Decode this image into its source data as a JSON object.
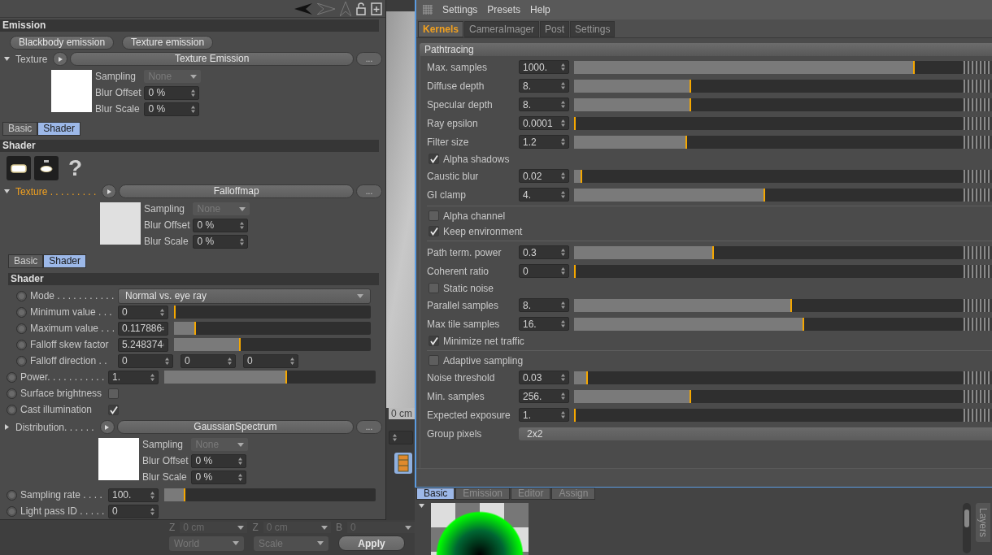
{
  "attribute_panel": {
    "blocks": [
      {
        "kind": "header",
        "title": "Emission"
      },
      {
        "kind": "buttons",
        "buttons": [
          "Blackbody emission",
          "Texture emission"
        ]
      },
      {
        "kind": "link",
        "label": "Texture",
        "expanded": true,
        "highlighted": false,
        "shader": "Texture Emission",
        "more": "...",
        "color": "#ffffff",
        "params": [
          {
            "kind": "dropdown",
            "label": "Sampling",
            "value": "None",
            "disabled": true
          },
          {
            "kind": "spinner",
            "label": "Blur Offset",
            "value": "0 %"
          },
          {
            "kind": "spinner",
            "label": "Blur Scale",
            "value": "0 %"
          }
        ]
      },
      {
        "kind": "tabs",
        "tabs": [
          {
            "label": "Basic",
            "selected": false
          },
          {
            "label": "Shader",
            "selected": true
          }
        ]
      },
      {
        "kind": "header",
        "title": "Shader"
      },
      {
        "kind": "icons",
        "help": "?"
      },
      {
        "kind": "link",
        "label": "Texture . . . . . . . . .",
        "expanded": true,
        "highlighted": true,
        "shader": "Falloffmap",
        "more": "...",
        "color": "#e0e0e0",
        "params": [
          {
            "kind": "dropdown",
            "label": "Sampling",
            "value": "None",
            "disabled": true
          },
          {
            "kind": "spinner",
            "label": "Blur Offset",
            "value": "0 %"
          },
          {
            "kind": "spinner",
            "label": "Blur Scale",
            "value": "0 %"
          }
        ],
        "children": [
          {
            "kind": "tabs",
            "tabs": [
              {
                "label": "Basic",
                "selected": false
              },
              {
                "label": "Shader",
                "selected": true
              }
            ]
          },
          {
            "kind": "header",
            "title": "Shader"
          },
          {
            "kind": "dropdown",
            "label": "Mode . . . . . . . . . . .",
            "value": "Normal vs. eye ray"
          },
          {
            "kind": "slider",
            "label": "Minimum value . . .",
            "value": "0",
            "level": 0
          },
          {
            "kind": "slider",
            "label": "Maximum value . . .",
            "value": "0.117886",
            "level": 0.11
          },
          {
            "kind": "slider",
            "label": "Falloff skew factor",
            "value": "5.248374",
            "level": 0.34
          },
          {
            "kind": "vector",
            "label": "Falloff direction . .",
            "values": [
              "0",
              "0",
              "0"
            ]
          }
        ]
      },
      {
        "kind": "slider",
        "label": "Power. . . . . . . . . . .",
        "value": "1.",
        "level": 0.58
      },
      {
        "kind": "check",
        "label": "Surface brightness",
        "checked": false
      },
      {
        "kind": "check",
        "label": "Cast illumination",
        "checked": true
      },
      {
        "kind": "link",
        "label": "Distribution. . . . . .",
        "expanded": false,
        "highlighted": false,
        "shader": "GaussianSpectrum",
        "more": "...",
        "color": "#ffffff",
        "params": [
          {
            "kind": "dropdown",
            "label": "Sampling",
            "value": "None",
            "disabled": true
          },
          {
            "kind": "spinner",
            "label": "Blur Offset",
            "value": "0 %"
          },
          {
            "kind": "spinner",
            "label": "Blur Scale",
            "value": "0 %"
          }
        ]
      },
      {
        "kind": "slider",
        "label": "Sampling rate . . . .",
        "value": "100.",
        "level": 0.1
      },
      {
        "kind": "number",
        "label": "Light pass ID . . . . .",
        "value": "0"
      }
    ]
  },
  "viewport": {
    "unit": "0 cm"
  },
  "coordinates": {
    "disabled": true,
    "fields": [
      {
        "axis": "Z",
        "value": "0 cm"
      },
      {
        "axis": "Z",
        "value": "0 cm"
      },
      {
        "axis": "B",
        "value": "0"
      }
    ],
    "dropdowns": [
      "World",
      "Scale"
    ],
    "apply": "Apply"
  },
  "render_settings": {
    "menu": [
      "Settings",
      "Presets",
      "Help"
    ],
    "tabs": [
      {
        "label": "Kernels",
        "selected": true
      },
      {
        "label": "CameraImager",
        "selected": false
      },
      {
        "label": "Post",
        "selected": false
      },
      {
        "label": "Settings",
        "selected": false
      }
    ],
    "section": "Pathtracing",
    "groups": [
      {
        "items": [
          {
            "kind": "slider",
            "label": "Max. samples",
            "value": "1000.",
            "level": 0.875
          },
          {
            "kind": "slider",
            "label": "Diffuse depth",
            "value": "8.",
            "level": 0.3
          },
          {
            "kind": "slider",
            "label": "Specular depth",
            "value": "8.",
            "level": 0.3
          },
          {
            "kind": "slider",
            "label": "Ray epsilon",
            "value": "0.0001",
            "level": 0
          },
          {
            "kind": "slider",
            "label": "Filter size",
            "value": "1.2",
            "level": 0.29
          },
          {
            "kind": "checkbox",
            "label": "Alpha shadows",
            "checked": true
          },
          {
            "kind": "slider",
            "label": "Caustic blur",
            "value": "0.02",
            "level": 0.02
          },
          {
            "kind": "slider",
            "label": "GI clamp",
            "value": "4.",
            "level": 0.49
          }
        ]
      },
      {
        "items": [
          {
            "kind": "checkbox",
            "label": "Alpha channel",
            "checked": false
          },
          {
            "kind": "checkbox",
            "label": "Keep environment",
            "checked": true
          }
        ]
      },
      {
        "items": [
          {
            "kind": "slider",
            "label": "Path term. power",
            "value": "0.3",
            "level": 0.36
          },
          {
            "kind": "slider",
            "label": "Coherent ratio",
            "value": "0",
            "level": 0
          },
          {
            "kind": "checkbox",
            "label": "Static noise",
            "checked": false
          },
          {
            "kind": "slider",
            "label": "Parallel samples",
            "value": "8.",
            "level": 0.56
          },
          {
            "kind": "slider",
            "label": "Max tile samples",
            "value": "16.",
            "level": 0.59
          },
          {
            "kind": "checkbox",
            "label": "Minimize net traffic",
            "checked": true
          }
        ]
      },
      {
        "items": [
          {
            "kind": "checkbox",
            "label": "Adaptive sampling",
            "checked": false
          },
          {
            "kind": "slider",
            "label": "Noise threshold",
            "value": "0.03",
            "level": 0.035
          },
          {
            "kind": "slider",
            "label": "Min. samples",
            "value": "256.",
            "level": 0.3
          },
          {
            "kind": "slider",
            "label": "Expected exposure",
            "value": "1.",
            "level": 0
          },
          {
            "kind": "select",
            "label": "Group pixels",
            "value": "2x2"
          }
        ]
      }
    ]
  },
  "material_manager": {
    "tabs": [
      {
        "label": "Basic",
        "selected": true
      },
      {
        "label": "Emission",
        "selected": false
      },
      {
        "label": "Editor",
        "selected": false
      },
      {
        "label": "Assign",
        "selected": false
      }
    ],
    "expanded": true,
    "side_tab": "Layers"
  }
}
